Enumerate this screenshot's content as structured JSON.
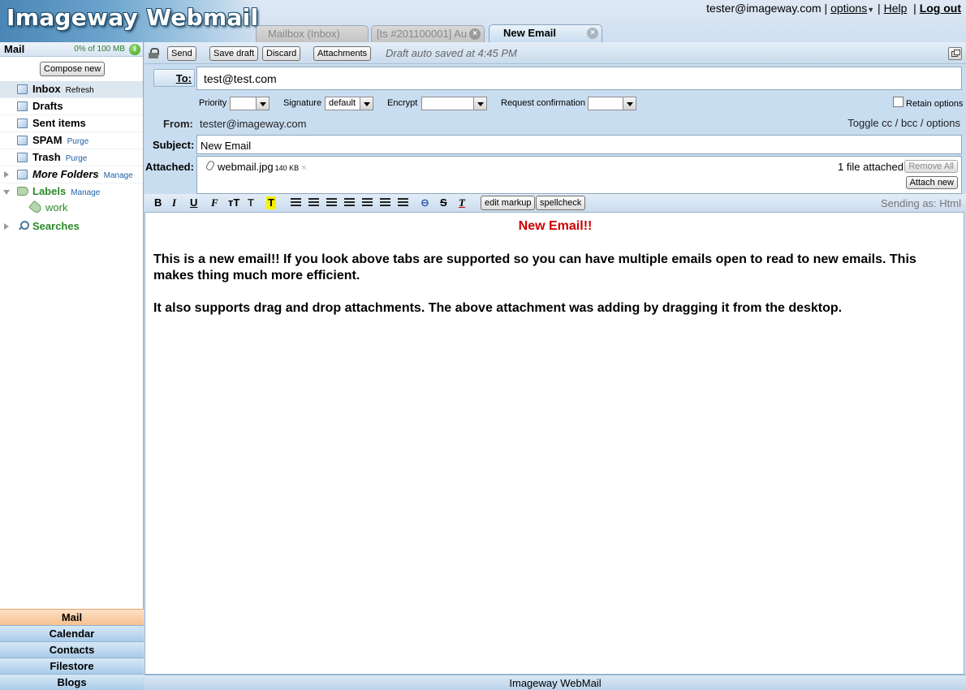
{
  "app": {
    "logo": "Imageway Webmail"
  },
  "header": {
    "user_email": "tester@imageway.com",
    "options_label": "options",
    "help_label": "Help",
    "logout_label": "Log out",
    "tabs": [
      {
        "label": "Mailbox (Inbox)"
      },
      {
        "label": "[ts #201100001] Au"
      },
      {
        "label": "New Email"
      }
    ]
  },
  "sidebar": {
    "section_title": "Mail",
    "quota": "0% of 100 MB",
    "compose_label": "Compose new",
    "folders": [
      {
        "name": "Inbox",
        "action": "Refresh"
      },
      {
        "name": "Drafts"
      },
      {
        "name": "Sent items"
      },
      {
        "name": "SPAM",
        "action": "Purge"
      },
      {
        "name": "Trash",
        "action": "Purge"
      },
      {
        "name": "More Folders",
        "action": "Manage"
      }
    ],
    "labels": {
      "name": "Labels",
      "action": "Manage",
      "items": [
        "work"
      ]
    },
    "searches": "Searches",
    "nav": [
      "Mail",
      "Calendar",
      "Contacts",
      "Filestore",
      "Blogs"
    ]
  },
  "toolbar": {
    "send": "Send",
    "save_draft": "Save draft",
    "discard": "Discard",
    "attachments": "Attachments",
    "status": "Draft auto saved at 4:45 PM"
  },
  "compose": {
    "to_label": "To:",
    "to_value": "test@test.com",
    "options": {
      "priority_label": "Priority",
      "priority_value": "",
      "signature_label": "Signature",
      "signature_value": "default",
      "encrypt_label": "Encrypt",
      "encrypt_value": "",
      "request_label": "Request confirmation",
      "request_value": "",
      "retain_label": "Retain options"
    },
    "from_label": "From:",
    "from_value": "tester@imageway.com",
    "toggle_cc": "Toggle cc / bcc / options",
    "subject_label": "Subject:",
    "subject_value": "New Email",
    "attached_label": "Attached:",
    "attachment": {
      "name": "webmail.jpg",
      "size": "140 KB",
      "remove": "×"
    },
    "attached_count": "1 file attached",
    "remove_all": "Remove All",
    "attach_new": "Attach new"
  },
  "format_bar": {
    "bold": "B",
    "italic": "I",
    "underline": "U",
    "font": "F",
    "size": "тT",
    "color": "T",
    "highlight": "T",
    "link": "⊖",
    "strike": "S",
    "clear": "T",
    "edit_markup": "edit markup",
    "spellcheck": "spellcheck",
    "sending_as": "Sending as: Html"
  },
  "email": {
    "heading": "New Email!!",
    "paragraphs": [
      "This is a new email!! If you look above tabs are supported so you can have multiple emails open to read to new emails.  This makes thing much more efficient.",
      "It also supports drag and drop attachments.  The above attachment was adding by dragging it from the desktop."
    ]
  },
  "footer": {
    "text": "Imageway WebMail"
  },
  "colors": {
    "accent_red": "#cc0000",
    "label_green": "#2a8a2a",
    "nav_active": "#f7c18f"
  }
}
